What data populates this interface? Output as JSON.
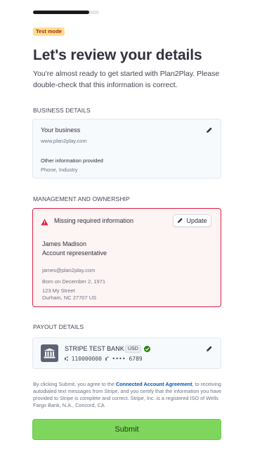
{
  "progress": {
    "fraction": 0.85
  },
  "badge": "Test mode",
  "title": "Let's review your details",
  "subtitle": "You're almost ready to get started with Plan2Play. Please double-check that this information is correct.",
  "business": {
    "section_label": "BUSINESS DETAILS",
    "heading": "Your business",
    "website": "www.plan2play.com",
    "other_heading": "Other information provided",
    "other_value": "Phone, Industry"
  },
  "management": {
    "section_label": "MANAGEMENT AND OWNERSHIP",
    "warning": "Missing required information",
    "update_label": "Update",
    "name": "James Madison",
    "role": "Account representative",
    "email": "james@plan2play.com",
    "dob": "Born on December 2, 1971",
    "address_line1": "123 My Street",
    "address_line2": "Durham, NC 27707 US"
  },
  "payout": {
    "section_label": "PAYOUT DETAILS",
    "bank_name": "STRIPE TEST BANK",
    "currency": "USD",
    "account": "⑆ 110000000 ⑈ •••• 6789"
  },
  "legal": {
    "before_link": "By clicking Submit, you agree to the ",
    "link": "Connected Account Agreement",
    "after_link": ", to receiving autodialed text messages from Stripe, and you certify that the information you have provided to Stripe is complete and correct. Stripe, Inc. is a registered ISO of Wells Fargo Bank, N.A., Concord, CA"
  },
  "submit_label": "Submit",
  "colors": {
    "accent": "#7ed65d",
    "danger": "#df1b41",
    "link": "#0055bc",
    "success": "#228403"
  },
  "icons": [
    "pencil-icon",
    "warning-icon",
    "bank-icon",
    "check-circle-icon"
  ]
}
